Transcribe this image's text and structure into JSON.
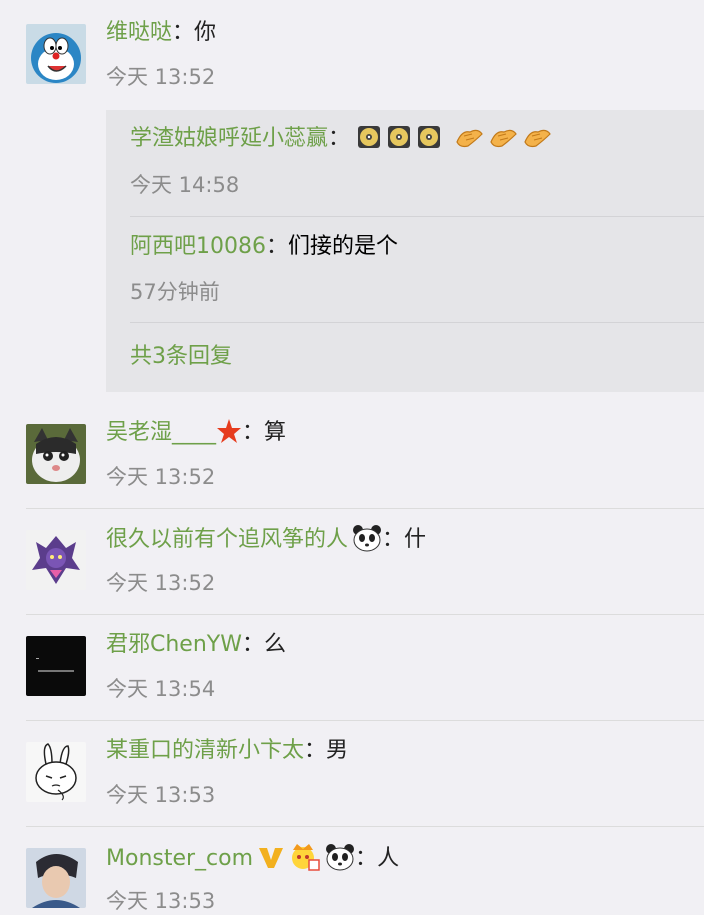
{
  "comments": [
    {
      "username": "维哒哒",
      "colon": "：",
      "text": "你",
      "time": "今天 13:52"
    },
    {
      "username": "吴老湿____",
      "colon": "：",
      "text": "算",
      "time": "今天 13:52"
    },
    {
      "username": "很久以前有个追风筝的人",
      "colon": "：",
      "text": "什",
      "time": "今天 13:52"
    },
    {
      "username": "君邪ChenYW",
      "colon": "：",
      "text": "么",
      "time": "今天 13:54"
    },
    {
      "username": "某重口的清新小卞太",
      "colon": "：",
      "text": "男",
      "time": "今天 13:53"
    },
    {
      "username": "Monster_com",
      "colon": "：",
      "text": "人",
      "time": "今天 13:53"
    }
  ],
  "replies": [
    {
      "username": "学渣姑娘呼延小蕊赢",
      "colon": "：",
      "text": "",
      "time": "今天 14:58",
      "emoji_icons": [
        "disc-icon",
        "disc-icon",
        "disc-icon",
        "clap-hand-icon",
        "clap-hand-icon",
        "clap-hand-icon"
      ]
    },
    {
      "username": "阿西吧10086",
      "colon": "：",
      "text": "们接的是个",
      "time": "57分钟前"
    }
  ],
  "more_replies_label": "共3条回复",
  "colors": {
    "username": "#6ea049",
    "time": "#8c8c8c",
    "background": "#f1f0f4",
    "reply_bg": "#e5e5e8"
  }
}
